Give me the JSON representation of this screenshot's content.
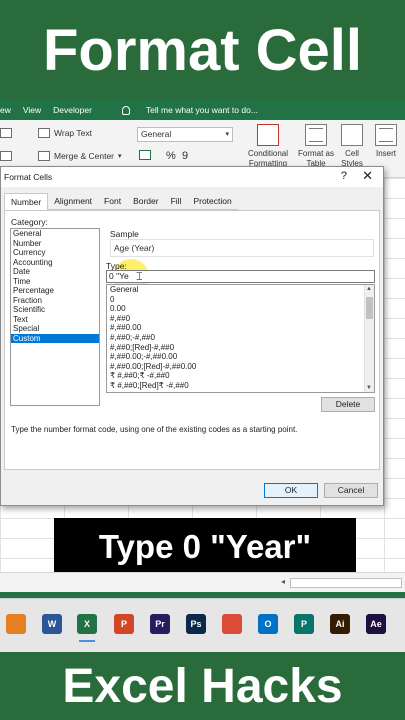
{
  "banner": {
    "top": "Format Cell",
    "bottom": "Excel Hacks"
  },
  "ribbon_tabs": [
    "ew",
    "View",
    "Developer"
  ],
  "tell_me": "Tell me what you want to do...",
  "ribbon": {
    "wrap_text": "Wrap Text",
    "merge_center": "Merge & Center",
    "number_format_value": "General",
    "currency_symbol": "$",
    "percent_symbol": "%",
    "comma_symbol": "9",
    "conditional_formatting": "Conditional Formatting",
    "format_as_table": "Format as Table",
    "cell_styles": "Cell Styles",
    "insert": "Insert"
  },
  "dialog": {
    "title": "Format Cells",
    "help": "?",
    "close": "✕",
    "tabs": [
      "Number",
      "Alignment",
      "Font",
      "Border",
      "Fill",
      "Protection"
    ],
    "category_label": "Category:",
    "categories": [
      "General",
      "Number",
      "Currency",
      "Accounting",
      "Date",
      "Time",
      "Percentage",
      "Fraction",
      "Scientific",
      "Text",
      "Special",
      "Custom"
    ],
    "selected_category": "Custom",
    "sample_label": "Sample",
    "sample_value": "Age (Year)",
    "type_label": "Type:",
    "type_value": "0 \"Ye",
    "formats": [
      "General",
      "0",
      "0.00",
      "#,##0",
      "#,##0.00",
      "#,##0;-#,##0",
      "#,##0;[Red]-#,##0",
      "#,##0.00;-#,##0.00",
      "#,##0.00;[Red]-#,##0.00",
      "₹ #,##0;₹ -#,##0",
      "₹ #,##0;[Red]₹ -#,##0"
    ],
    "delete_label": "Delete",
    "hint": "Type the number format code, using one of the existing codes as a starting point.",
    "ok_label": "OK",
    "cancel_label": "Cancel"
  },
  "caption": "Type 0 \"Year\"",
  "taskbar": [
    {
      "name": "app-icon",
      "color": "#e67e22",
      "glyph": ""
    },
    {
      "name": "word-icon",
      "color": "#2b579a",
      "glyph": "W"
    },
    {
      "name": "excel-icon",
      "color": "#217346",
      "glyph": "X"
    },
    {
      "name": "powerpoint-icon",
      "color": "#d24726",
      "glyph": "P"
    },
    {
      "name": "premiere-icon",
      "color": "#2a1a5e",
      "glyph": "Pr"
    },
    {
      "name": "photoshop-icon",
      "color": "#0b2a4a",
      "glyph": "Ps"
    },
    {
      "name": "chrome-icon",
      "color": "#dd4b39",
      "glyph": ""
    },
    {
      "name": "outlook-icon",
      "color": "#0072c6",
      "glyph": "O"
    },
    {
      "name": "publisher-icon",
      "color": "#077568",
      "glyph": "P"
    },
    {
      "name": "illustrator-icon",
      "color": "#331c00",
      "glyph": "Ai"
    },
    {
      "name": "after-effects-icon",
      "color": "#1f0f3f",
      "glyph": "Ae"
    }
  ]
}
